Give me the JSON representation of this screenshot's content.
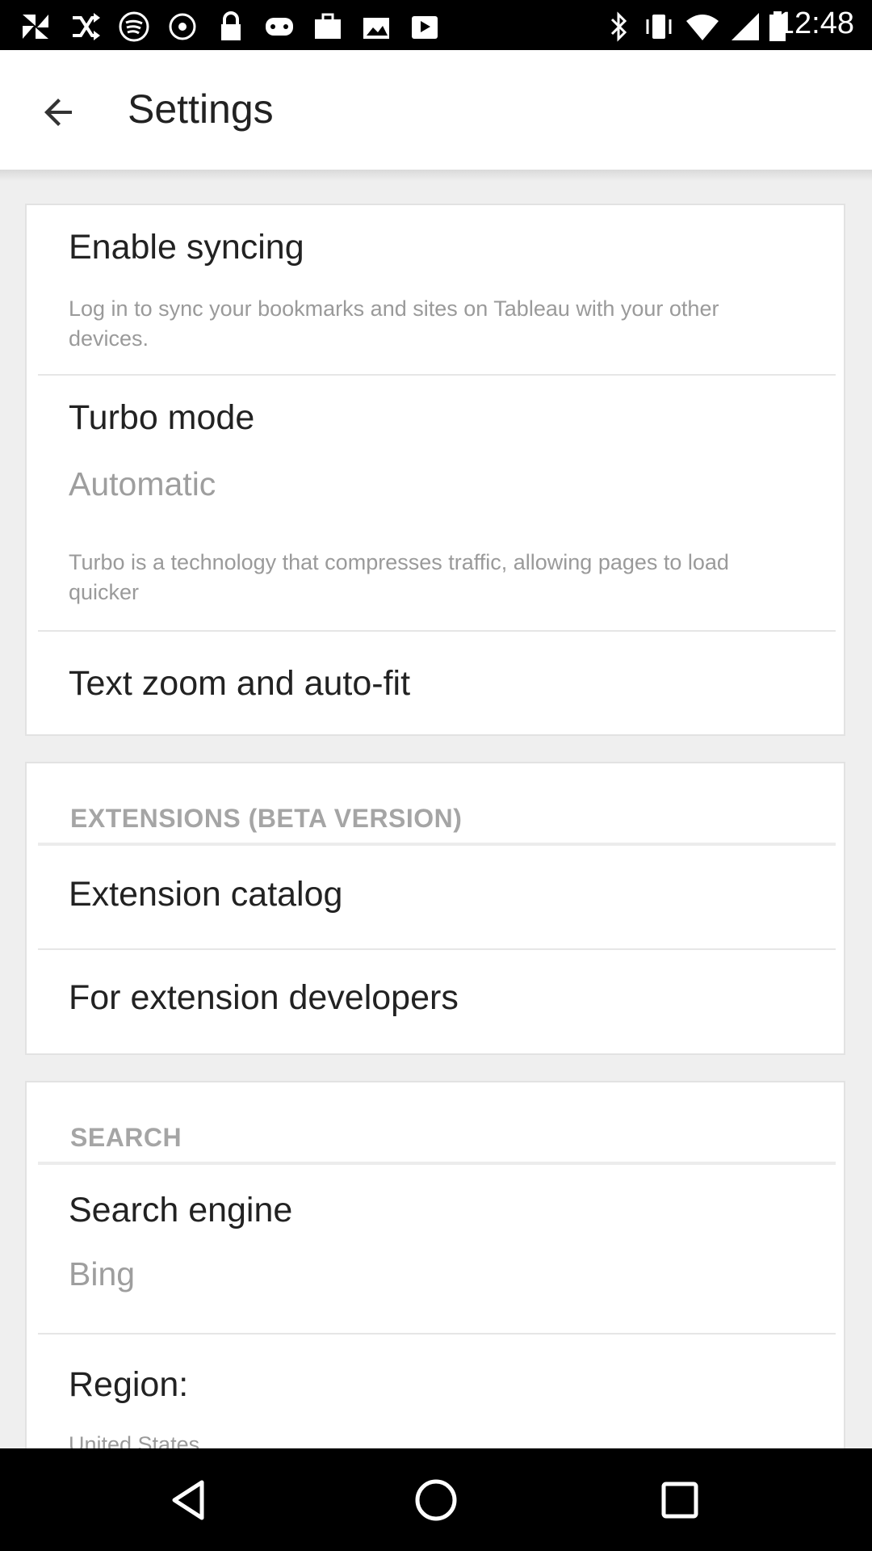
{
  "status_bar": {
    "time": "12:48",
    "left_icons": [
      "pinwheel-icon",
      "shuffle-icon",
      "spotify-icon",
      "fake-gps-icon",
      "lock-icon",
      "game-icon",
      "briefcase-icon",
      "image-upload-icon",
      "video-icon"
    ],
    "right_icons": [
      "bluetooth-icon",
      "vibrate-icon",
      "wifi-icon",
      "signal-icon",
      "battery-icon"
    ]
  },
  "app_bar": {
    "title": "Settings",
    "back_icon": "arrow-back-icon"
  },
  "sync_card": {
    "enable_syncing": {
      "title": "Enable syncing",
      "subtitle": "Log in to sync your bookmarks and sites on Tableau with your other devices."
    },
    "turbo_mode": {
      "title": "Turbo mode",
      "value": "Automatic",
      "subtitle": "Turbo is a technology that compresses traffic, allowing pages to load quicker"
    },
    "text_zoom": {
      "title": "Text zoom and auto-fit"
    }
  },
  "extensions_card": {
    "header": "EXTENSIONS (BETA VERSION)",
    "items": [
      {
        "title": "Extension catalog"
      },
      {
        "title": "For extension developers"
      }
    ]
  },
  "search_card": {
    "header": "SEARCH",
    "search_engine": {
      "title": "Search engine",
      "value": "Bing"
    },
    "region": {
      "title": "Region:",
      "value": "United States"
    }
  },
  "nav_bar": {
    "buttons": [
      "back-triangle-icon",
      "home-circle-icon",
      "recents-square-icon"
    ]
  }
}
